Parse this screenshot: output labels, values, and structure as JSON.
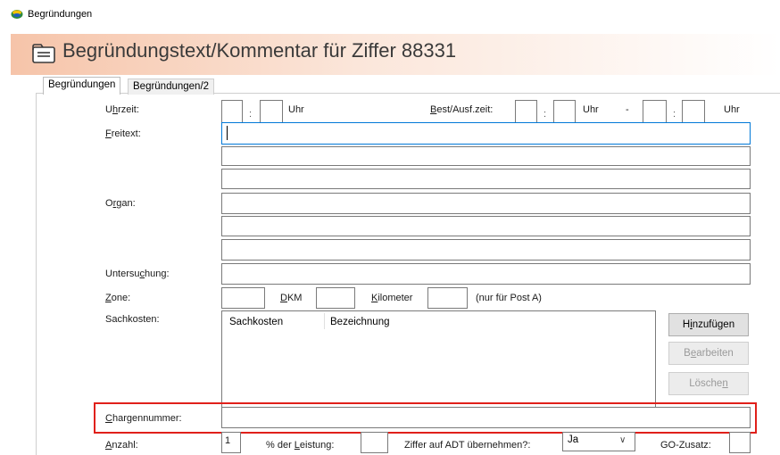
{
  "window": {
    "title": "Begründungen"
  },
  "header": {
    "title": "Begründungstext/Kommentar für Ziffer 88331"
  },
  "tabs": [
    {
      "label": "Begründungen"
    },
    {
      "label": "Begründungen/2"
    }
  ],
  "form": {
    "uhrzeit_label": "Uhrzeit:",
    "uhr1": "Uhr",
    "colon": ":",
    "best_ausf_label": "Best/Ausf.zeit:",
    "uhr2": "Uhr",
    "dash": "-",
    "uhr3": "Uhr",
    "freitext_label": "Freitext:",
    "organ_label": "Organ:",
    "untersuchung_label": "Untersuchung:",
    "zone_label": "Zone:",
    "dkm_label": "DKM",
    "kilometer_label": "Kilometer",
    "post_a_note": "(nur für Post A)",
    "sachkosten_label": "Sachkosten:",
    "chargennummer_label": "Chargennummer:",
    "anzahl_label": "Anzahl:",
    "anzahl_value": "1",
    "leistung_label": "% der Leistung:",
    "adt_label": "Ziffer auf ADT übernehmen?:",
    "adt_value": "Ja",
    "go_zusatz_label": "GO-Zusatz:"
  },
  "sachkosten_table": {
    "columns": [
      "Sachkosten",
      "Bezeichnung"
    ]
  },
  "buttons": {
    "add": "Hinzufügen",
    "edit": "Bearbeiten",
    "delete": "Löschen"
  },
  "colors": {
    "highlight": "#e0201a",
    "focus": "#0078d7"
  },
  "icons": [
    "app-logo-icon",
    "folder-document-icon",
    "chevron-down-icon"
  ]
}
